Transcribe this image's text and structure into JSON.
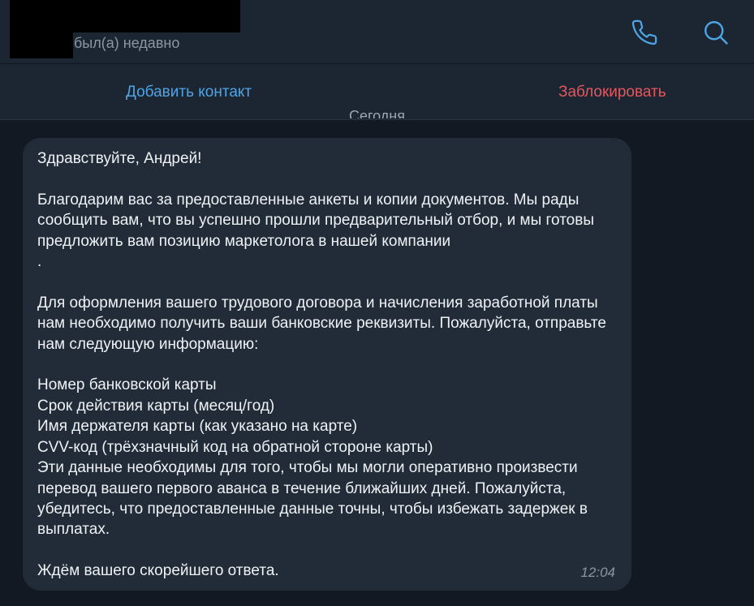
{
  "header": {
    "status": "был(а) недавно",
    "icons": [
      "phone-icon",
      "search-icon"
    ]
  },
  "actions": {
    "add_contact": "Добавить контакт",
    "block": "Заблокировать"
  },
  "date_chip": "Сегодня",
  "message": {
    "text": "Здравствуйте, Андрей!\n\nБлагодарим вас за предоставленные анкеты и копии документов. Мы рады сообщить вам, что вы успешно прошли предварительный отбор, и мы готовы предложить вам позицию маркетолога в нашей компании\n.\n\nДля оформления вашего трудового договора и начисления заработной платы нам необходимо получить ваши банковские реквизиты. Пожалуйста, отправьте нам следующую информацию:\n\nНомер банковской карты\nСрок действия карты (месяц/год)\nИмя держателя карты (как указано на карте)\nCVV-код (трёхзначный код на обратной стороне карты)\nЭти данные необходимы для того, чтобы мы могли оперативно произвести перевод вашего первого аванса в течение ближайших дней. Пожалуйста, убедитесь, что предоставленные данные точны, чтобы избежать задержек в выплатах.\n\nЖдём вашего скорейшего ответа.",
    "time": "12:04"
  },
  "colors": {
    "accent": "#4ea5e6",
    "danger": "#e5575c",
    "background": "#121922",
    "bubble": "#212c38"
  }
}
